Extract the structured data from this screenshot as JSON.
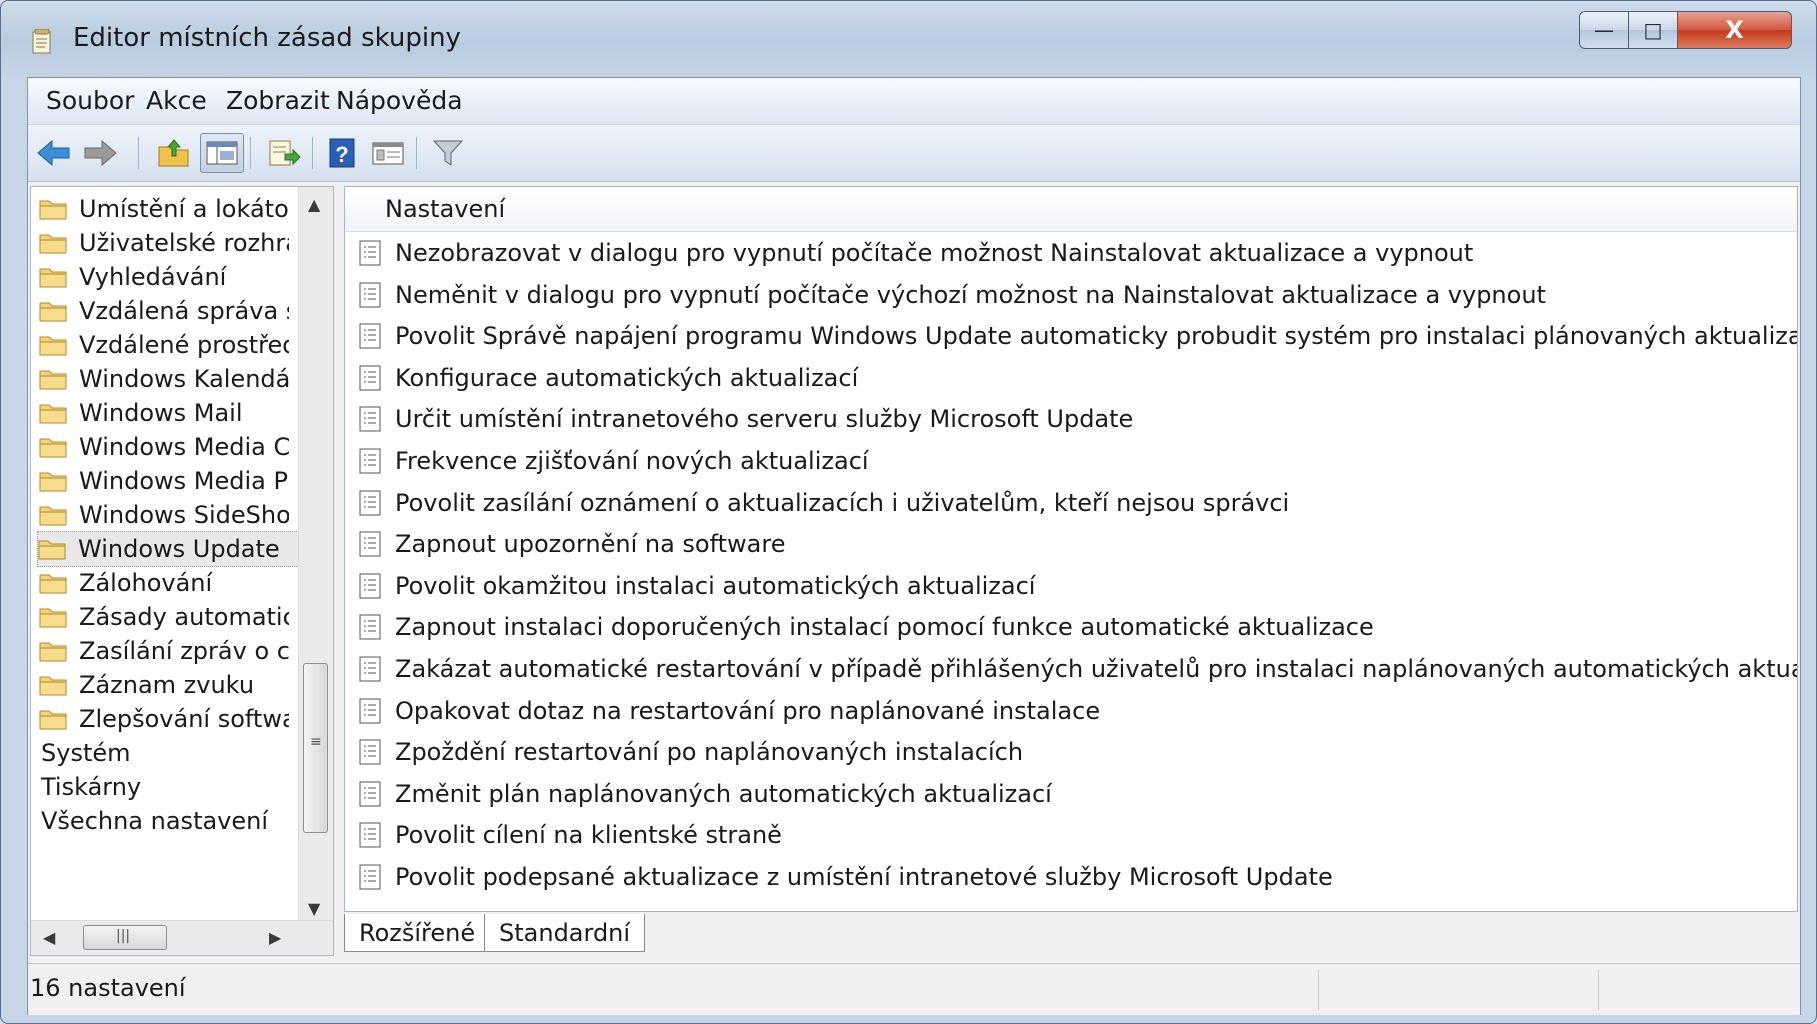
{
  "window": {
    "title": "Editor místních zásad skupiny"
  },
  "window_controls": {
    "minimize": "—",
    "maximize": "□",
    "close": "X"
  },
  "menubar": {
    "items": [
      "Soubor",
      "Akce",
      "Zobrazit",
      "Nápověda"
    ]
  },
  "toolbar": {
    "icons": [
      "back-arrow-icon",
      "forward-arrow-icon",
      "up-folder-icon",
      "show-hide-tree-icon",
      "export-list-icon",
      "help-icon",
      "properties-icon",
      "filter-icon"
    ]
  },
  "tree": {
    "items": [
      "Umístění a lokátor",
      "Uživatelské rozhraní",
      "Vyhledávání",
      "Vzdálená správa systému",
      "Vzdálené prostředí",
      "Windows Kalendář",
      "Windows Mail",
      "Windows Media Center",
      "Windows Media Player",
      "Windows SideShow",
      "Windows Update",
      "Zálohování",
      "Zásady automatického přehrávání",
      "Zasílání zpráv o chybách",
      "Záznam zvuku",
      "Zlepšování softwaru"
    ],
    "selected_index": 10,
    "plain_items": [
      "Systém",
      "Tiskárny",
      "Všechna nastavení"
    ]
  },
  "list": {
    "header": "Nastavení",
    "rows": [
      "Nezobrazovat v dialogu pro vypnutí počítače možnost Nainstalovat aktualizace a vypnout",
      "Neměnit v dialogu pro vypnutí počítače výchozí možnost na Nainstalovat aktualizace a vypnout",
      "Povolit Správě napájení programu Windows Update automaticky probudit systém pro instalaci plánovaných aktualizací",
      "Konfigurace automatických aktualizací",
      "Určit umístění intranetového serveru služby Microsoft Update",
      "Frekvence zjišťování nových aktualizací",
      "Povolit zasílání oznámení o aktualizacích i uživatelům, kteří nejsou správci",
      "Zapnout upozornění na software",
      "Povolit okamžitou instalaci automatických aktualizací",
      "Zapnout instalaci doporučených instalací pomocí funkce automatické aktualizace",
      "Zakázat automatické restartování v případě přihlášených uživatelů pro instalaci naplánovaných automatických aktualizací",
      "Opakovat dotaz na restartování pro naplánované instalace",
      "Zpoždění restartování po naplánovaných instalacích",
      "Změnit plán naplánovaných automatických aktualizací",
      "Povolit cílení na klientské straně",
      "Povolit podepsané aktualizace z umístění intranetové služby Microsoft Update"
    ]
  },
  "tabs": {
    "extended": "Rozšířené",
    "standard": "Standardní"
  },
  "status": {
    "text": "16 nastavení"
  }
}
